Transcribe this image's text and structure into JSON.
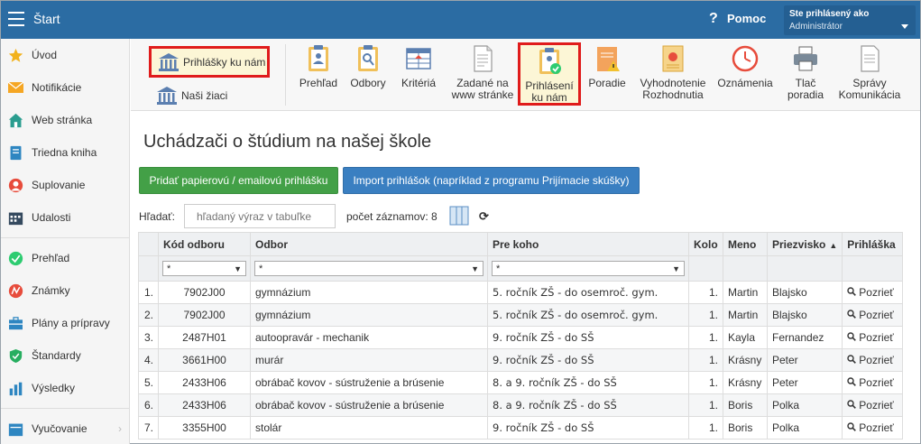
{
  "header": {
    "title": "Štart",
    "help_label": "Pomoc",
    "user_line1": "Ste prihlásený ako",
    "user_line2": "Administrátor"
  },
  "sidebar": {
    "items": [
      {
        "label": "Úvod",
        "icon": "star-icon",
        "color": "#f2b21c"
      },
      {
        "label": "Notifikácie",
        "icon": "envelope-icon",
        "color": "#f5a623"
      },
      {
        "label": "Web stránka",
        "icon": "home-icon",
        "color": "#2a9d8f"
      },
      {
        "label": "Triedna kniha",
        "icon": "book-icon",
        "color": "#2e86c1"
      },
      {
        "label": "Suplovanie",
        "icon": "person-icon",
        "color": "#e74c3c"
      },
      {
        "label": "Udalosti",
        "icon": "calendar-icon",
        "color": "#34495e"
      },
      {
        "label": "Prehľad",
        "icon": "check-circle-icon",
        "color": "#2ecc71"
      },
      {
        "label": "Známky",
        "icon": "grade-icon",
        "color": "#e74c3c"
      },
      {
        "label": "Plány a prípravy",
        "icon": "briefcase-icon",
        "color": "#2e86c1"
      },
      {
        "label": "Štandardy",
        "icon": "shield-icon",
        "color": "#27ae60"
      },
      {
        "label": "Výsledky",
        "icon": "bar-chart-icon",
        "color": "#2e86c1"
      },
      {
        "label": "Vyučovanie",
        "icon": "calendar-icon",
        "color": "#2e86c1"
      }
    ]
  },
  "toolbar": {
    "applications_label": "Prihlášky ku nám",
    "students_label": "Naši žiaci",
    "tools": [
      {
        "line1": "Prehľad",
        "line2": ""
      },
      {
        "line1": "Odbory",
        "line2": ""
      },
      {
        "line1": "Kritériá",
        "line2": ""
      },
      {
        "line1": "Zadané na",
        "line2": "www stránke"
      },
      {
        "line1": "Prihlásení",
        "line2": "ku nám"
      },
      {
        "line1": "Poradie",
        "line2": ""
      },
      {
        "line1": "Vyhodnotenie",
        "line2": "Rozhodnutia"
      },
      {
        "line1": "Oznámenia",
        "line2": ""
      },
      {
        "line1": "Tlač",
        "line2": "poradia"
      },
      {
        "line1": "Správy",
        "line2": "Komunikácia"
      }
    ]
  },
  "main": {
    "title": "Uchádzači o štúdium na našej škole",
    "add_button": "Pridať papierovú / emailovú prihlášku",
    "import_button": "Import prihlášok (napríklad z programu Prijímacie skúšky)",
    "search_label": "Hľadať:",
    "search_placeholder": "hľadaný výraz v tabuľke",
    "record_count": "počet záznamov: 8"
  },
  "table": {
    "columns": [
      "",
      "Kód odboru",
      "Odbor",
      "Pre koho",
      "Kolo",
      "Meno",
      "Priezvisko",
      "Prihláška"
    ],
    "filter_value": "*",
    "view_label": "Pozrieť",
    "rows": [
      {
        "n": "1.",
        "code": "7902J00",
        "field": "gymnázium",
        "for": "5. ročník ZŠ - do osemroč. gym.",
        "round": "1.",
        "name": "Martin",
        "surname": "Blajsko"
      },
      {
        "n": "2.",
        "code": "7902J00",
        "field": "gymnázium",
        "for": "5. ročník ZŠ - do osemroč. gym.",
        "round": "1.",
        "name": "Martin",
        "surname": "Blajsko"
      },
      {
        "n": "3.",
        "code": "2487H01",
        "field": "autoopravár - mechanik",
        "for": "9. ročník ZŠ - do SŠ",
        "round": "1.",
        "name": "Kayla",
        "surname": "Fernandez"
      },
      {
        "n": "4.",
        "code": "3661H00",
        "field": "murár",
        "for": "9. ročník ZŠ - do SŠ",
        "round": "1.",
        "name": "Krásny",
        "surname": "Peter"
      },
      {
        "n": "5.",
        "code": "2433H06",
        "field": "obrábač kovov - sústruženie a brúsenie",
        "for": "8. a 9. ročník ZŠ - do SŠ",
        "round": "1.",
        "name": "Krásny",
        "surname": "Peter"
      },
      {
        "n": "6.",
        "code": "2433H06",
        "field": "obrábač kovov - sústruženie a brúsenie",
        "for": "8. a 9. ročník ZŠ - do SŠ",
        "round": "1.",
        "name": "Boris",
        "surname": "Polka"
      },
      {
        "n": "7.",
        "code": "3355H00",
        "field": "stolár",
        "for": "9. ročník ZŠ - do SŠ",
        "round": "1.",
        "name": "Boris",
        "surname": "Polka"
      }
    ]
  },
  "colors": {
    "header": "#2b6ca3",
    "highlight_border": "#e01b1b",
    "green_button": "#43a047",
    "blue_button": "#3a7fc1"
  }
}
